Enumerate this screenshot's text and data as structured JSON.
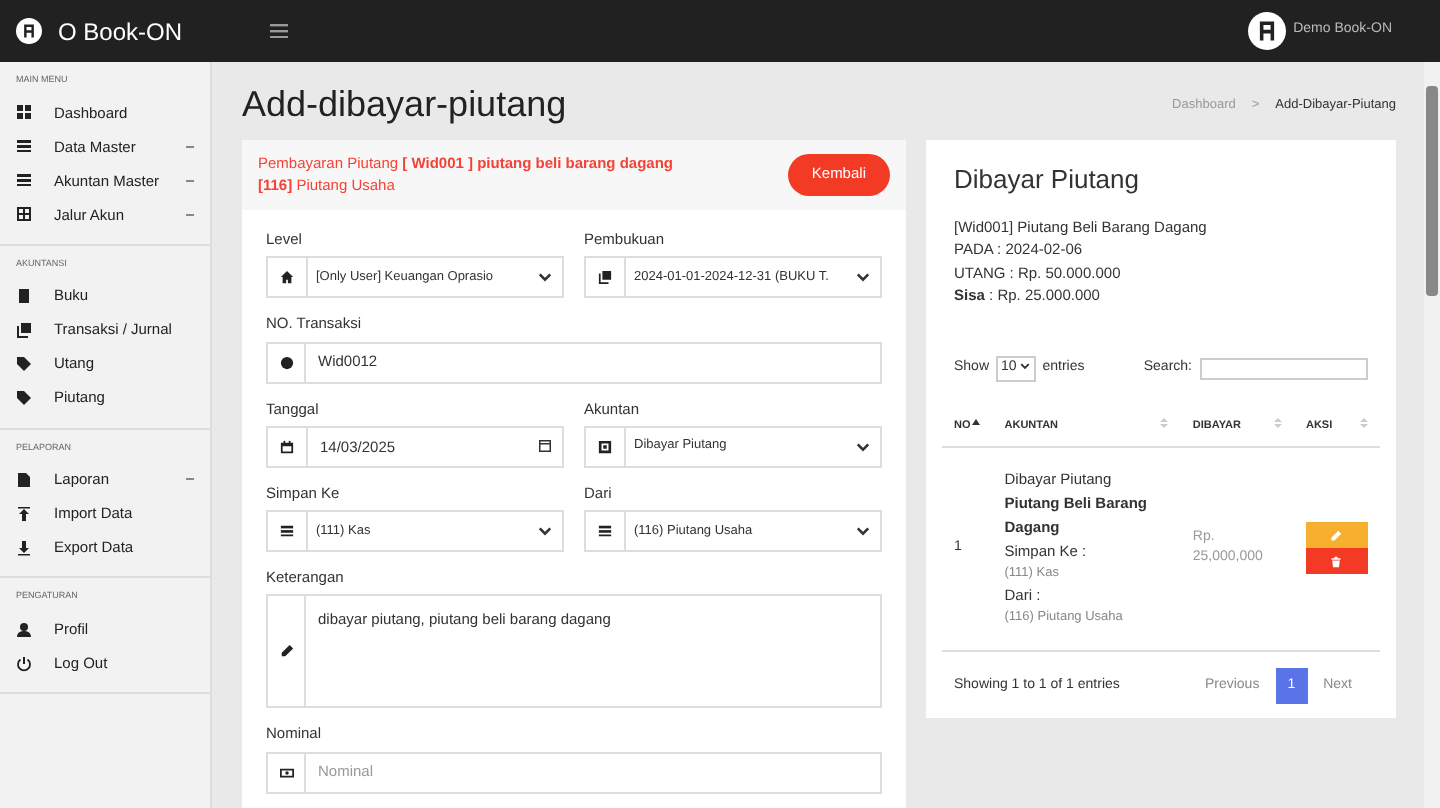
{
  "brand": {
    "name": "O Book-ON"
  },
  "user": {
    "name": "Demo Book-ON"
  },
  "sidebar": [
    {
      "title": "MAIN MENU",
      "items": [
        {
          "label": "Dashboard",
          "expandable": false
        },
        {
          "label": "Data Master",
          "expandable": true
        },
        {
          "label": "Akuntan Master",
          "expandable": true
        },
        {
          "label": "Jalur Akun",
          "expandable": true
        }
      ]
    },
    {
      "title": "AKUNTANSI",
      "items": [
        {
          "label": "Buku",
          "expandable": false
        },
        {
          "label": "Transaksi / Jurnal",
          "expandable": false
        },
        {
          "label": "Utang",
          "expandable": false
        },
        {
          "label": "Piutang",
          "expandable": false
        }
      ]
    },
    {
      "title": "PELAPORAN",
      "items": [
        {
          "label": "Laporan",
          "expandable": true
        },
        {
          "label": "Import Data",
          "expandable": false
        },
        {
          "label": "Export Data",
          "expandable": false
        }
      ]
    },
    {
      "title": "PENGATURAN",
      "items": [
        {
          "label": "Profil",
          "expandable": false
        },
        {
          "label": "Log Out",
          "expandable": false
        }
      ]
    }
  ],
  "page_title": "Add-dibayar-piutang",
  "breadcrumb_separator": ">",
  "breadcrumb": [
    {
      "label": "Dashboard",
      "active": false
    },
    {
      "label": "Add-Dibayar-Piutang",
      "active": true
    }
  ],
  "form": {
    "header_lines": [
      "Pembayaran Piutang **[ Wid001 ] piutang beli barang dagang**",
      "**[116]** Piutang Usaha"
    ],
    "back_button": "Kembali",
    "rows": [
      [
        {
          "label": "Level",
          "kind": "select",
          "value": "[Only User] Keuangan Oprasio"
        },
        {
          "label": "Pembukuan",
          "kind": "select",
          "value": "2024-01-01-2024-12-31 (BUKU T."
        }
      ],
      [
        {
          "label": "NO. Transaksi",
          "kind": "input",
          "value": "Wid0012"
        }
      ],
      [
        {
          "label": "Tanggal",
          "kind": "date",
          "value": "14/03/2025"
        },
        {
          "label": "Akuntan",
          "kind": "select",
          "value": "Dibayar Piutang"
        }
      ],
      [
        {
          "label": "Simpan Ke",
          "kind": "select",
          "value": "(111) Kas"
        },
        {
          "label": "Dari",
          "kind": "select",
          "value": "(116) Piutang Usaha"
        }
      ],
      [
        {
          "label": "Keterangan",
          "kind": "textarea",
          "value": "dibayar piutang, piutang beli barang dagang"
        }
      ],
      [
        {
          "label": "Nominal",
          "kind": "input",
          "placeholder": "Nominal"
        }
      ]
    ]
  },
  "summary": {
    "title": "Dibayar Piutang",
    "lines": [
      "[Wid001] Piutang Beli Barang Dagang",
      "PADA : 2024-02-06",
      "UTANG : Rp. 50.000.000",
      "**Sisa** : Rp. 25.000.000"
    ]
  },
  "table": {
    "show_label": "Show",
    "length": "10",
    "entries_label": "entries",
    "search_label": "Search:",
    "columns": [
      {
        "label": "NO",
        "sorted": true
      },
      {
        "label": "AKUNTAN",
        "sorted": false
      },
      {
        "label": "DIBAYAR",
        "sorted": false
      },
      {
        "label": "AKSI",
        "sorted": false
      }
    ],
    "rows": [
      {
        "no": "1",
        "akuntan": [
          {
            "text": "Dibayar Piutang",
            "kind": "plain"
          },
          {
            "text": "Piutang Beli Barang Dagang",
            "kind": "bold"
          },
          {
            "text": "Simpan Ke :",
            "kind": "heading"
          },
          {
            "text": "(111) Kas",
            "kind": "muted"
          },
          {
            "text": "Dari :",
            "kind": "heading"
          },
          {
            "text": "(116) Piutang Usaha",
            "kind": "muted"
          }
        ],
        "dibayar": "Rp. 25,000,000"
      }
    ],
    "info": "Showing 1 to 1 of 1 entries",
    "pagination": [
      {
        "label": "Previous",
        "selected": false
      },
      {
        "label": "1",
        "selected": true
      },
      {
        "label": "Next",
        "selected": false
      }
    ]
  }
}
